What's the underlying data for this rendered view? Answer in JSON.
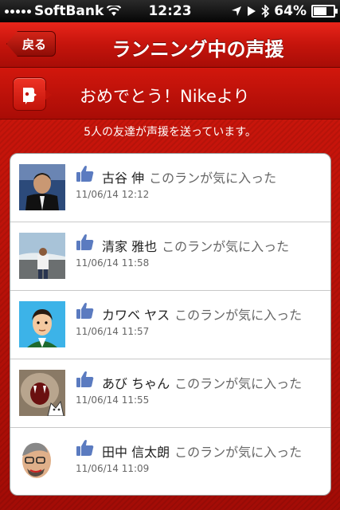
{
  "status_bar": {
    "carrier": "SoftBank",
    "time": "12:23",
    "battery": "64%"
  },
  "nav": {
    "back_label": "戻る",
    "title": "ランニング中の声援"
  },
  "banner": {
    "text": "おめでとう！Nikeより"
  },
  "subtitle": "5人の友達が声援を送っています。",
  "cheers": [
    {
      "name": "古谷 伸",
      "action": "このランが気に入った",
      "date": "11/06/14 12:12",
      "avatar": "photo-man-suit"
    },
    {
      "name": "清家 雅也",
      "action": "このランが気に入った",
      "date": "11/06/14 11:58",
      "avatar": "photo-man-beach"
    },
    {
      "name": "カワベ ヤス",
      "action": "このランが気に入った",
      "date": "11/06/14 11:57",
      "avatar": "illustration-cartoon-man"
    },
    {
      "name": "あび ちゃん",
      "action": "このランが気に入った",
      "date": "11/06/14 11:55",
      "avatar": "photo-cat"
    },
    {
      "name": "田中 信太朗",
      "action": "このランが気に入った",
      "date": "11/06/14 11:09",
      "avatar": "illustration-glasses-man"
    }
  ],
  "colors": {
    "nav_red": "#c5140c",
    "like_blue": "#5b7bc0"
  }
}
